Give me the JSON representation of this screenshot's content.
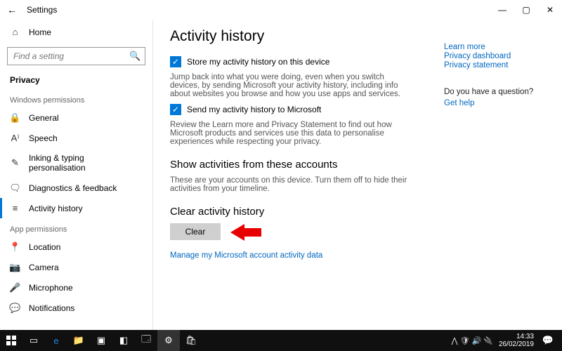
{
  "titlebar": {
    "title": "Settings"
  },
  "sidebar": {
    "home": "Home",
    "search_placeholder": "Find a setting",
    "privacy": "Privacy",
    "win_perm_header": "Windows permissions",
    "win_perm": [
      {
        "icon": "lock-icon",
        "label": "General"
      },
      {
        "icon": "speech-icon",
        "label": "Speech"
      },
      {
        "icon": "inking-icon",
        "label": "Inking & typing personalisation"
      },
      {
        "icon": "feedback-icon",
        "label": "Diagnostics & feedback"
      },
      {
        "icon": "activity-icon",
        "label": "Activity history"
      }
    ],
    "app_perm_header": "App permissions",
    "app_perm": [
      {
        "icon": "location-icon",
        "label": "Location"
      },
      {
        "icon": "camera-icon",
        "label": "Camera"
      },
      {
        "icon": "mic-icon",
        "label": "Microphone"
      },
      {
        "icon": "notifications-icon",
        "label": "Notifications"
      }
    ]
  },
  "main": {
    "title": "Activity history",
    "chk1": "Store my activity history on this device",
    "desc1": "Jump back into what you were doing, even when you switch devices, by sending Microsoft your activity history, including info about websites you browse and how you use apps and services.",
    "chk2": "Send my activity history to Microsoft",
    "desc2": "Review the Learn more and Privacy Statement to find out how Microsoft products and services use this data to personalise experiences while respecting your privacy.",
    "accounts_heading": "Show activities from these accounts",
    "accounts_desc": "These are your accounts on this device. Turn them off to hide their activities from your timeline.",
    "clear_heading": "Clear activity history",
    "clear_btn": "Clear",
    "manage_link": "Manage my Microsoft account activity data"
  },
  "right": {
    "learn_more": "Learn more",
    "dashboard": "Privacy dashboard",
    "statement": "Privacy statement",
    "question": "Do you have a question?",
    "get_help": "Get help"
  },
  "taskbar": {
    "time": "14:33",
    "date": "26/02/2019"
  }
}
